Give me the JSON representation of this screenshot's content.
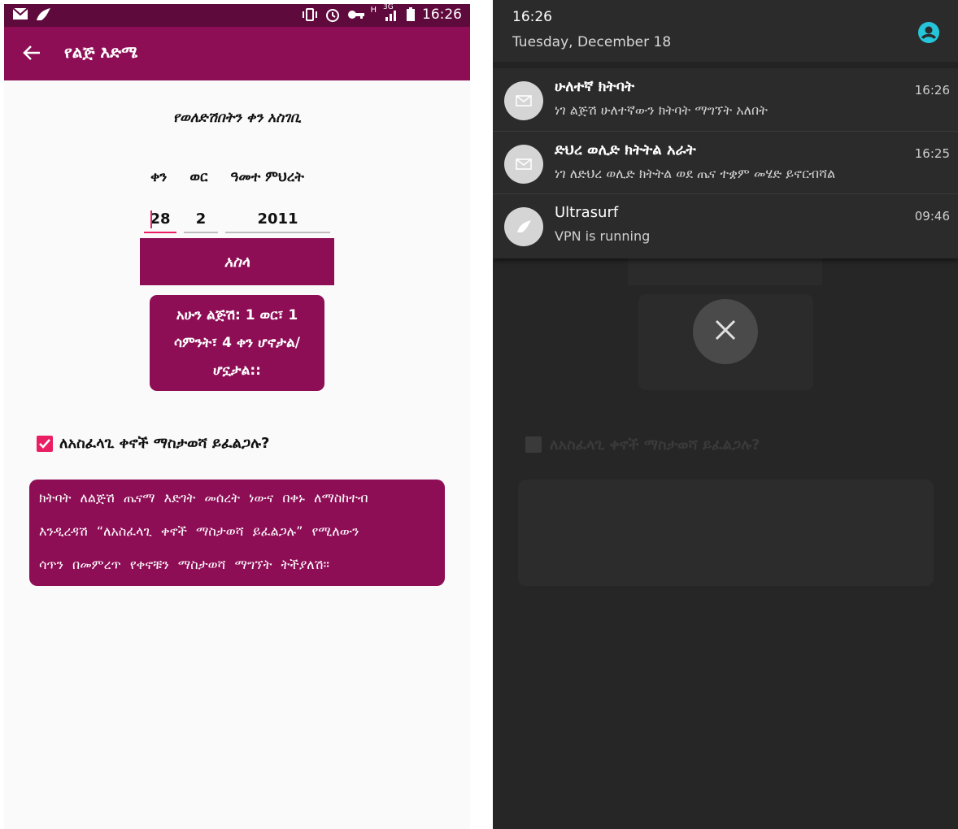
{
  "left_screen": {
    "status_bar": {
      "time": "16:26",
      "network": "3G",
      "network_h": "H",
      "icons": [
        "mail-icon",
        "ultrasurf-icon",
        "vibrate-icon",
        "alarm-icon",
        "key-icon",
        "signal-icon",
        "battery-icon"
      ]
    },
    "app_bar": {
      "title": "የልጅ እድሜ",
      "back_icon": "arrow-left-icon"
    },
    "form": {
      "heading": "የወለድሽበትን ቀን አስገቢ",
      "labels": {
        "day": "ቀን",
        "month": "ወር",
        "year": "ዓመተ ምህረት"
      },
      "values": {
        "day": "28",
        "month": "2",
        "year": "2011"
      },
      "calculate_label": "አስላ"
    },
    "result": {
      "line1": "አሁን ልጅሽ: 1 ወር፣ 1",
      "line2": "ሳምንት፣ 4 ቀን ሆኖታል/",
      "line3": "ሆኗታል::"
    },
    "reminder": {
      "checked": true,
      "label": "ለአስፈላጊ ቀኖች ማስታወሻ ይፈልጋሉ?"
    },
    "info": {
      "line1": "ክትባት ለልጅሽ ጤናማ እድገት መሰረት ነውና በቀኑ ለማስከተብ",
      "line2": "እንዲረዳሽ “ለአስፈላጊ ቀኖች ማስታወሻ ይፈልጋሉ” የሚለውን",
      "line3": "ሳጥን በመምረጥ የቀኖቹን ማስታወሻ ማግኘት ትችያለሽ።"
    },
    "colors": {
      "primary": "#8e0e56",
      "status": "#5f0a3c",
      "accent": "#e91e63"
    }
  },
  "right_screen": {
    "shade": {
      "time": "16:26",
      "date": "Tuesday, December 18",
      "avatar_icon": "account-circle-icon",
      "avatar_color": "#26c6da"
    },
    "notifications": [
      {
        "icon": "mail-icon",
        "title": "ሁለተኛ ክትባት",
        "body": "ነገ ልጅሽ ሁለተኛውን ክትባት ማግኘት አለበት",
        "time": "16:26"
      },
      {
        "icon": "mail-icon",
        "title": "ድህረ ወሊድ ክትትል አራት",
        "body": "ነገ ለድህረ ወሊድ ክትትል ወደ ጤና ተቋም መሄድ ይኖርብሻል",
        "time": "16:25"
      },
      {
        "icon": "ultrasurf-icon",
        "title": "Ultrasurf",
        "body": "VPN is running",
        "time": "09:46"
      }
    ],
    "close_icon": "close-icon"
  }
}
